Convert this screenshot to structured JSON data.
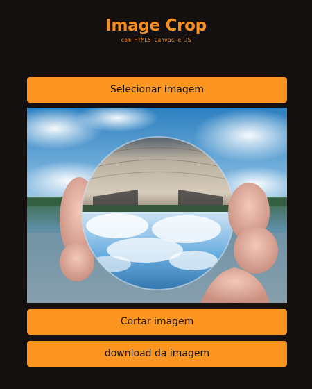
{
  "header": {
    "title": "Image Crop",
    "subtitle": "com HTML5 Canvas e JS"
  },
  "buttons": {
    "select_label": "Selecionar imagem",
    "crop_label": "Cortar imagem",
    "download_label": "download da imagem"
  },
  "colors": {
    "background": "#141010",
    "accent": "#fb951f"
  }
}
